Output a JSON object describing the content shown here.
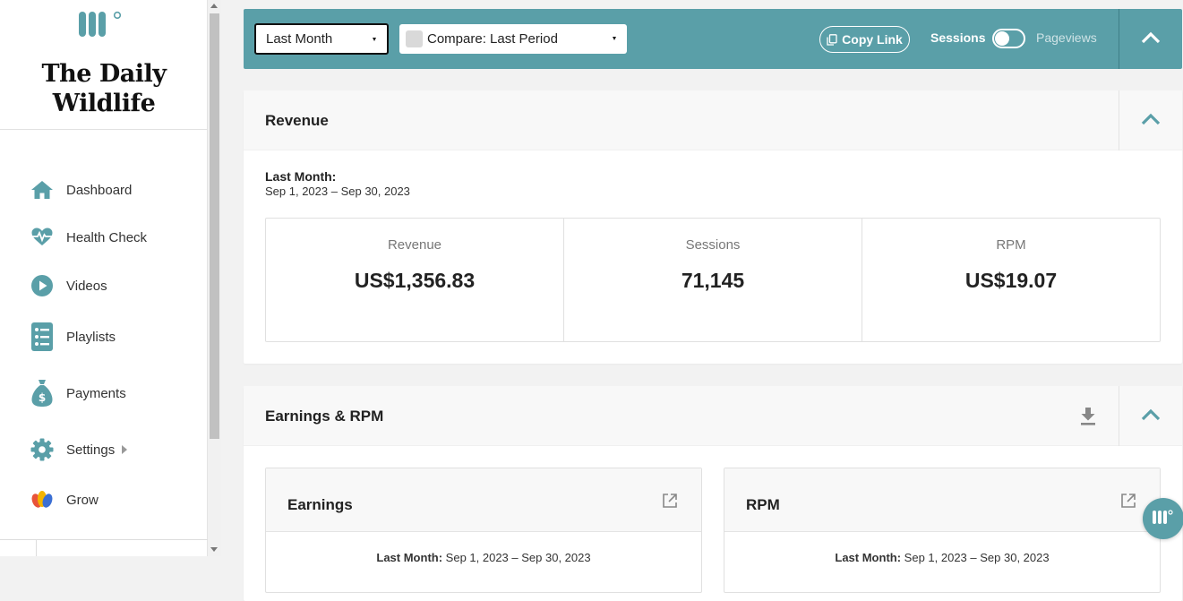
{
  "brand": {
    "line1": "The Daily",
    "line2": "Wildlife"
  },
  "nav": {
    "items": [
      {
        "label": "Dashboard",
        "icon": "home-icon"
      },
      {
        "label": "Health Check",
        "icon": "heart-pulse-icon"
      },
      {
        "label": "Videos",
        "icon": "play-circle-icon"
      },
      {
        "label": "Playlists",
        "icon": "list-icon"
      },
      {
        "label": "Payments",
        "icon": "money-bag-icon"
      },
      {
        "label": "Settings",
        "icon": "gear-icon"
      },
      {
        "label": "Grow",
        "icon": "grow-logo-icon"
      }
    ]
  },
  "toolbar": {
    "period_value": "Last Month",
    "compare_value": "Compare: Last Period",
    "copy_link": "Copy Link",
    "toggle_left": "Sessions",
    "toggle_right": "Pageviews"
  },
  "revenue": {
    "title": "Revenue",
    "period_label": "Last Month:",
    "period_range": "Sep 1, 2023 – Sep 30, 2023",
    "stats": [
      {
        "label": "Revenue",
        "value": "US$1,356.83"
      },
      {
        "label": "Sessions",
        "value": "71,145"
      },
      {
        "label": "RPM",
        "value": "US$19.07"
      }
    ]
  },
  "earnings": {
    "title": "Earnings & RPM",
    "cards": [
      {
        "title": "Earnings",
        "period_label": "Last Month:",
        "period_range": "Sep 1, 2023 – Sep 30, 2023"
      },
      {
        "title": "RPM",
        "period_label": "Last Month:",
        "period_range": "Sep 1, 2023 – Sep 30, 2023"
      }
    ]
  },
  "colors": {
    "accent": "#5a9fa8",
    "background": "#f2f2f2"
  }
}
